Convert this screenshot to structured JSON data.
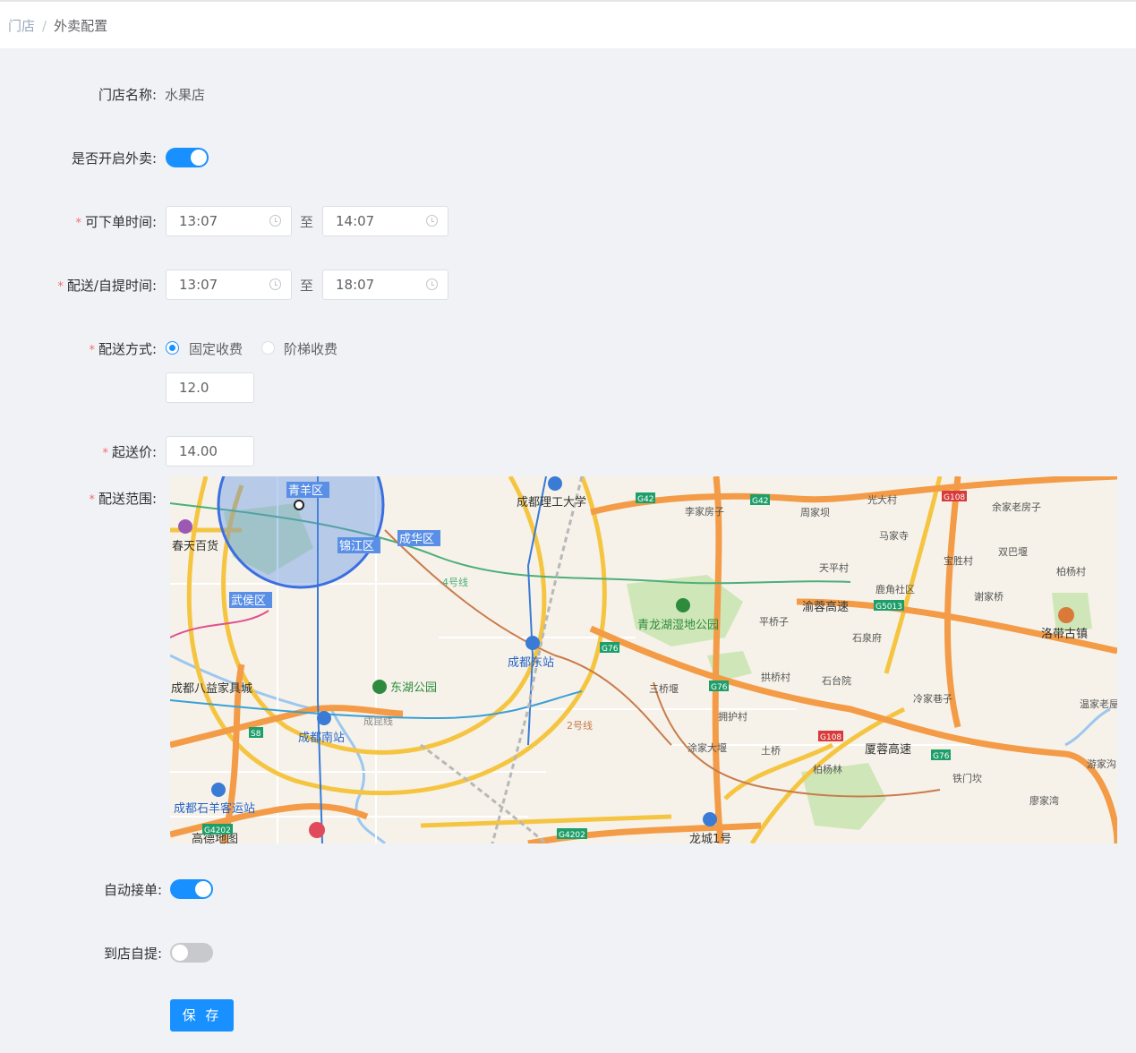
{
  "breadcrumb": {
    "home": "门店",
    "separator": "/",
    "current": "外卖配置"
  },
  "form": {
    "store_name": {
      "label": "门店名称:",
      "value": "水果店"
    },
    "enable_delivery": {
      "label": "是否开启外卖:",
      "on": true
    },
    "order_time": {
      "label": "可下单时间:",
      "start": "13:07",
      "to": "至",
      "end": "14:07"
    },
    "delivery_time": {
      "label": "配送/自提时间:",
      "start": "13:07",
      "to": "至",
      "end": "18:07"
    },
    "delivery_method": {
      "label": "配送方式:",
      "options": [
        "固定收费",
        "阶梯收费"
      ],
      "selected": "固定收费",
      "fee": "12.0"
    },
    "min_price": {
      "label": "起送价:",
      "value": "14.00"
    },
    "delivery_range": {
      "label": "配送范围:"
    },
    "auto_accept": {
      "label": "自动接单:",
      "on": true
    },
    "self_pickup": {
      "label": "到店自提:",
      "on": false
    },
    "save_label": "保 存"
  },
  "map": {
    "logo": "高德地图",
    "labels": {
      "qingyang": "青羊区",
      "jinjiang": "锦江区",
      "chenghua": "成华区",
      "wuhou": "武侯区",
      "cdut": "成都理工大学",
      "chunxi": "春天百货",
      "dongzhan": "成都东站",
      "nanzhan": "成都南站",
      "dongpark": "东湖公园",
      "qinglong": "青龙湖湿地公园",
      "bapan": "成都八益家具城",
      "shiyang": "成都石羊客运站",
      "longcheng": "龙城1号",
      "luodai": "洛带古镇",
      "guangda": "光大村",
      "yujia": "余家老房子",
      "majia": "马家寺",
      "shuangba": "双巴堰",
      "tianping": "天平村",
      "lujiao": "鹿角社区",
      "xiejia": "谢家桥",
      "baiyang": "柏杨村",
      "pingqiao": "平桥子",
      "shiquan": "石泉府",
      "gongqiao": "拱桥村",
      "shitai": "石台院",
      "sanqiao": "三桥堰",
      "yonghu": "拥护村",
      "lengjia": "冷家巷子",
      "tujia": "涂家大堰",
      "tuqiao": "土桥",
      "bailin": "柏杨林",
      "tiemen": "铁门坎",
      "liaojia": "廖家湾",
      "wenjia": "温家老屋",
      "youjia": "游家沟",
      "lijia": "李家房子",
      "zhoujia": "周家坝",
      "baosheng": "宝胜村",
      "yurong": "渝蓉高速",
      "xiarong": "厦蓉高速",
      "line2": "2号线",
      "line4": "4号线",
      "chengmian": "成昆线",
      "g42": "G42",
      "g108": "G108",
      "g5013": "G5013",
      "g76": "G76",
      "s8": "S8",
      "g4202": "G4202"
    }
  }
}
